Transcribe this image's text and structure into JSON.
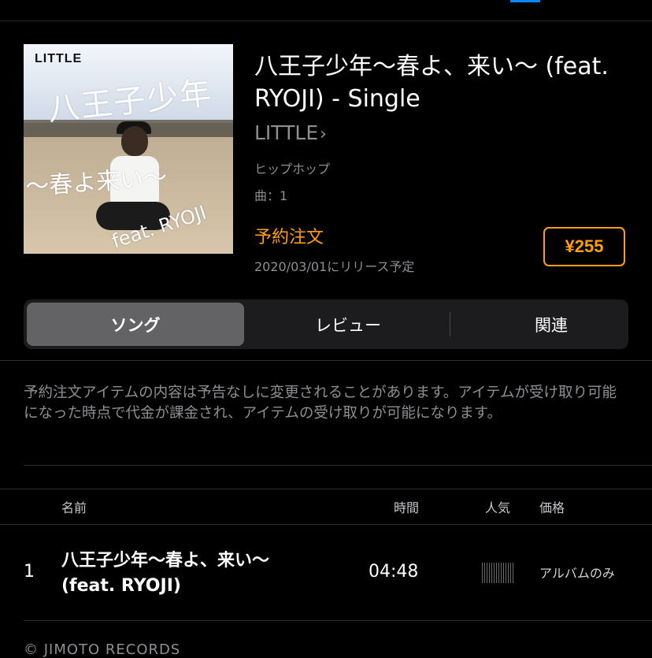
{
  "album": {
    "artwork_logo": "LITTLE",
    "artwork_title": "八王子少年",
    "artwork_subtitle": "〜春よ来い〜",
    "artwork_feat": "feat. RYOJI",
    "title": "八王子少年〜春よ、来い〜 (feat. RYOJI) - Single",
    "artist": "LITTLE",
    "genre": "ヒップホップ",
    "track_count": "曲：1",
    "preorder_label": "予約注文",
    "release_date": "2020/03/01にリリース予定",
    "price": "¥255"
  },
  "tabs": {
    "songs": "ソング",
    "reviews": "レビュー",
    "related": "関連"
  },
  "notice": "予約注文アイテムの内容は予告なしに変更されることがあります。アイテムが受け取り可能になった時点で代金が課金され、アイテムの受け取りが可能になります。",
  "table": {
    "headers": {
      "name": "名前",
      "time": "時間",
      "popularity": "人気",
      "price": "価格"
    },
    "rows": [
      {
        "number": "1",
        "title": "八王子少年〜春よ、来い〜 (feat. RYOJI)",
        "time": "04:48",
        "price": "アルバムのみ"
      }
    ]
  },
  "copyright": "© JIMOTO RECORDS",
  "colors": {
    "accent_orange": "#ff9f0a",
    "background": "#000000",
    "secondary_text": "#8e8e93"
  }
}
